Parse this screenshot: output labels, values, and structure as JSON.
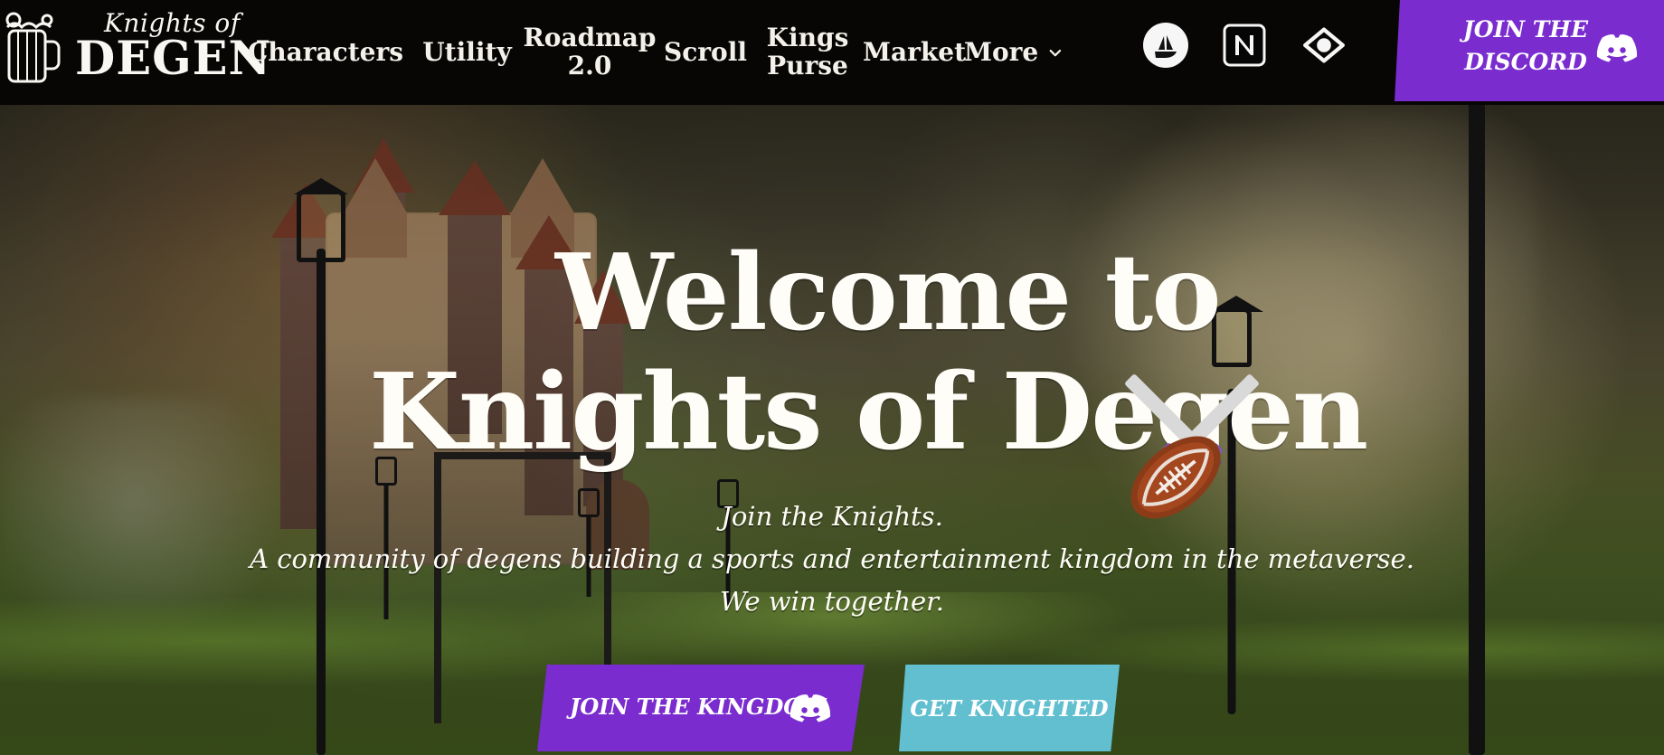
{
  "navbar": {
    "logo": {
      "top": "Knights of",
      "bottom": "DEGEN"
    },
    "items": [
      {
        "label": "Characters",
        "has_chevron": true
      },
      {
        "label": "Utility"
      },
      {
        "label": "Roadmap\n2.0"
      },
      {
        "label": "Scroll"
      },
      {
        "label": "Kings\nPurse"
      },
      {
        "label": "Market"
      },
      {
        "label": "More",
        "has_chevron": true
      }
    ],
    "icons": [
      {
        "name": "opensea-icon"
      },
      {
        "name": "notion-icon"
      },
      {
        "name": "eye-icon"
      }
    ],
    "join_discord": {
      "label": "JOIN THE\nDISCORD",
      "icon": "discord-icon"
    }
  },
  "hero": {
    "title_line_1": "Welcome to",
    "title_line_2": "Knights of Degen",
    "subtitle_line_1": "Join the Knights.",
    "subtitle_line_2": "A community of degens building a sports and entertainment kingdom in the metaverse.",
    "subtitle_line_3": "We win together.",
    "buttons": {
      "primary": {
        "label": "JOIN THE KINGDOM",
        "icon": "discord-icon"
      },
      "secondary": {
        "label": "GET KNIGHTED"
      }
    }
  },
  "colors": {
    "nav_bg": "#070604",
    "accent_purple": "#7a2cce",
    "accent_teal": "#61bfd0",
    "text_light": "#fffdf7"
  }
}
